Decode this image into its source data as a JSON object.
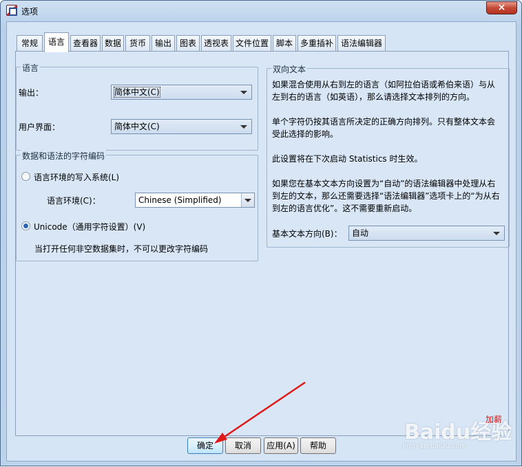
{
  "window": {
    "title": "选项",
    "close_icon": "×"
  },
  "tabs": [
    {
      "label": "常规"
    },
    {
      "label": "语言"
    },
    {
      "label": "查看器"
    },
    {
      "label": "数据"
    },
    {
      "label": "货币"
    },
    {
      "label": "输出"
    },
    {
      "label": "图表"
    },
    {
      "label": "透视表"
    },
    {
      "label": "文件位置"
    },
    {
      "label": "脚本"
    },
    {
      "label": "多重插补"
    },
    {
      "label": "语法编辑器"
    }
  ],
  "active_tab": "语言",
  "language_group": {
    "legend": "语言",
    "output_label": "输出：",
    "output_value": "简体中文(C)",
    "ui_label": "用户界面：",
    "ui_value": "简体中文(C)"
  },
  "encoding_group": {
    "legend": "数据和语法的字符编码",
    "locale_radio_label": "语言环境的写入系统(L)",
    "locale_env_label": "语言环境(C)：",
    "locale_env_value": "Chinese (Simplified)",
    "unicode_radio_label": "Unicode（通用字符设置）(V)",
    "note": "当打开任何非空数据集时，不可以更改字符编码",
    "selected": "unicode"
  },
  "bidi_group": {
    "legend": "双向文本",
    "para1": "如果混合使用从右到左的语言（如阿拉伯语或希伯来语）与从左到右的语言（如英语），那么请选择文本排列的方向。",
    "para2": "单个字符仍按其语言所决定的正确方向排列。只有整体文本会受此选择的影响。",
    "para3": "此设置将在下次启动 Statistics 时生效。",
    "para4": "如果您在基本文本方向设置为“自动”的语法编辑器中处理从右到左的文本，那么还需要选择“语法编辑器”选项卡上的“为从右到左的语言优化”。这不需要重新启动。",
    "direction_label": "基本文本方向(B)：",
    "direction_value": "自动"
  },
  "buttons": {
    "ok": "确定",
    "cancel": "取消",
    "apply": "应用(A)",
    "help": "帮助"
  },
  "watermark": {
    "text": "Baidu经验",
    "sub": "jingyan.baidu.com",
    "tag": "加薪"
  },
  "colors": {
    "annotation_arrow": "#e01818",
    "client_bg": "#d6e5f5"
  }
}
